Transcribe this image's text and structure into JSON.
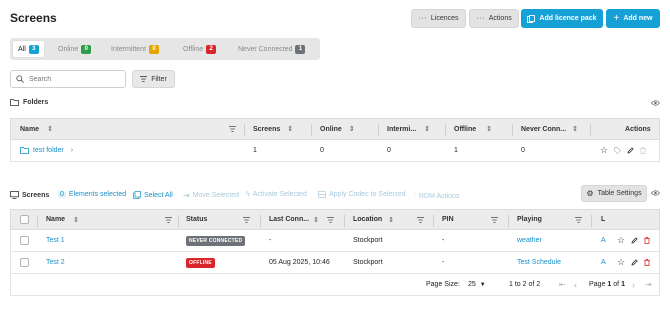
{
  "header": {
    "title": "Screens",
    "licences_label": "Licences",
    "actions_label": "Actions",
    "add_licence_pack_label": "Add licence pack",
    "add_new_label": "Add new"
  },
  "tabs": [
    {
      "label": "All",
      "count": "3",
      "color": "#15a0d6"
    },
    {
      "label": "Online",
      "count": "0",
      "color": "#2e9e4a"
    },
    {
      "label": "Intermittent",
      "count": "0",
      "color": "#e5a300"
    },
    {
      "label": "Offline",
      "count": "2",
      "color": "#d9262c"
    },
    {
      "label": "Never Connected",
      "count": "1",
      "color": "#6d7278"
    }
  ],
  "search": {
    "placeholder": "Search"
  },
  "filter_label": "Filter",
  "folders": {
    "title": "Folders",
    "columns": [
      "Name",
      "Screens",
      "Online",
      "Intermi...",
      "Offline",
      "Never Conn...",
      "Actions"
    ],
    "rows": [
      {
        "name": "test folder",
        "screens": "1",
        "online": "0",
        "intermittent": "0",
        "offline": "1",
        "never_connected": "0"
      }
    ]
  },
  "screens_toolbar": {
    "title": "Screens",
    "selected_count": "0",
    "selected_label": "Elements selected",
    "select_all": "Select All",
    "move_selected": "Move Selected",
    "activate_selected": "Activate Selected",
    "apply_codec": "Apply Codec to Selected",
    "rdm_actions": "RDM Actions",
    "table_settings": "Table Settings"
  },
  "screens_table": {
    "columns": [
      "Name",
      "Status",
      "Last Conn...",
      "Location",
      "PIN",
      "Playing",
      "L"
    ],
    "rows": [
      {
        "name": "Test 1",
        "status": "NEVER CONNECTED",
        "status_color": "#6d7278",
        "last_connected": "-",
        "location": "Stockport",
        "pin": "-",
        "playing": "weather",
        "l": "A"
      },
      {
        "name": "Test 2",
        "status": "OFFLINE",
        "status_color": "#d9262c",
        "last_connected": "05 Aug 2025, 10:46",
        "location": "Stockport",
        "pin": "-",
        "playing": "Test Schedule",
        "l": "A"
      }
    ]
  },
  "pagination": {
    "page_size_label": "Page Size:",
    "page_size": "25",
    "range": "1 to 2 of 2",
    "page_label": "Page",
    "page": "1",
    "of_label": "of",
    "total_pages": "1"
  }
}
